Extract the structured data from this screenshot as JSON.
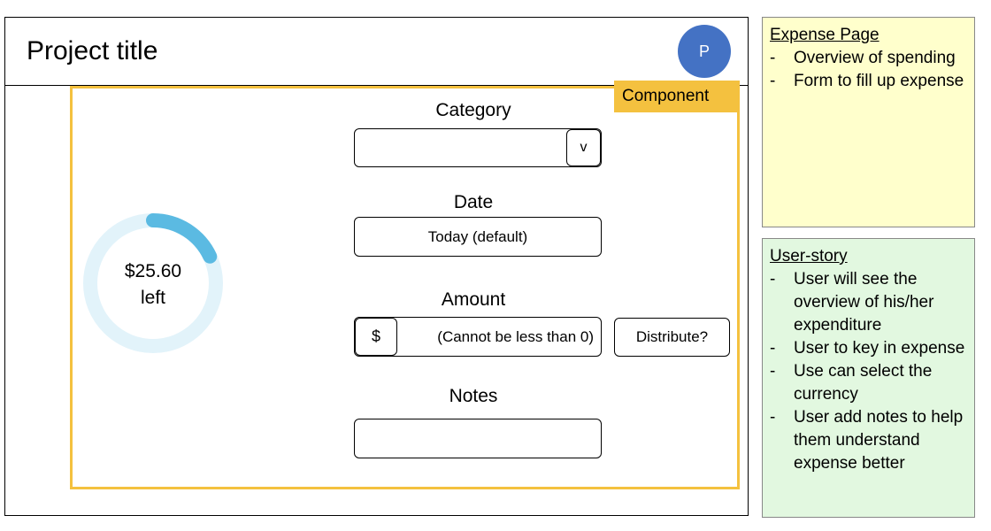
{
  "header": {
    "title": "Project title",
    "avatar_initial": "P"
  },
  "component_tag": "Component",
  "budget": {
    "amount_left": "$25.60",
    "left_label": "left",
    "ring_fill_fraction": 0.18,
    "ring_color": "#5bbae2",
    "ring_track_color": "#e2f3fa"
  },
  "form": {
    "category": {
      "label": "Category",
      "value": "",
      "chevron": "v"
    },
    "date": {
      "label": "Date",
      "value": "Today (default)"
    },
    "amount": {
      "label": "Amount",
      "currency": "$",
      "placeholder": "(Cannot be less than 0)",
      "distribute_label": "Distribute?"
    },
    "notes": {
      "label": "Notes",
      "value": ""
    }
  },
  "notes_panel": {
    "expense_page": {
      "title": "Expense Page",
      "items": [
        "Overview of spending",
        "Form to fill up expense"
      ]
    },
    "user_story": {
      "title": "User-story",
      "items": [
        "User will see the overview of his/her expenditure",
        "User to key in expense",
        "Use can select the currency",
        "User add notes to help them understand expense better"
      ]
    }
  },
  "colors": {
    "avatar": "#4472c4",
    "component_border": "#f4c13f",
    "note_yellow": "#ffffcc",
    "note_green": "#e2f8e0"
  }
}
